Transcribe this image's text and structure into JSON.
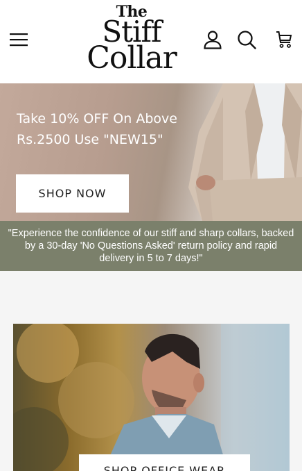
{
  "header": {
    "logo": {
      "line1": "The",
      "line2": "Stiff",
      "line3": "Collar"
    },
    "icons": {
      "menu": "menu-icon",
      "account": "user-icon",
      "search": "search-icon",
      "cart": "cart-icon"
    }
  },
  "hero": {
    "headline": "Take 10% OFF On Above Rs.2500 Use \"NEW15\"",
    "cta_label": "SHOP NOW"
  },
  "banner": {
    "text": "\"Experience the confidence of our stiff and sharp collars, backed by a 30-day 'No Questions Asked' return policy and rapid delivery in 5 to 7 days!\""
  },
  "collection_card": {
    "cta_label": "SHOP OFFICE WEAR"
  },
  "colors": {
    "banner_bg": "#7b806b",
    "page_bg": "#f5f5f5",
    "text_dark": "#111111"
  }
}
